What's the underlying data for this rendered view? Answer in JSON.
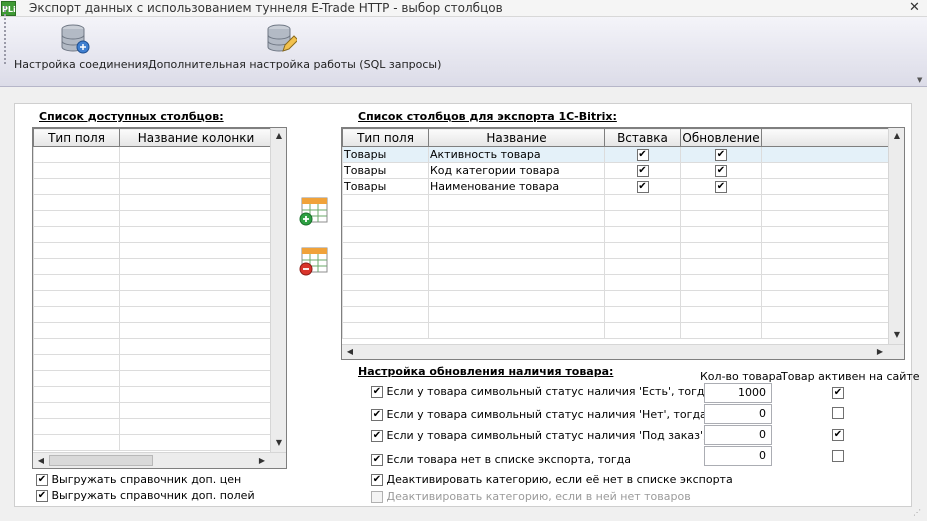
{
  "window": {
    "app_icon_text": "PLi",
    "title": "Экспорт данных с использованием туннеля E-Trade HTTP - выбор столбцов",
    "close_glyph": "✕"
  },
  "toolbar": {
    "btn_connection": "Настройка соединения",
    "btn_sql": "Дополнительная настройка работы (SQL запросы)"
  },
  "available": {
    "title": "Список доступных столбцов:",
    "columns": [
      "Тип поля",
      "Название колонки"
    ],
    "rows": []
  },
  "export": {
    "title": "Список столбцов для экспорта 1С-Bitrix:",
    "columns": [
      "Тип поля",
      "Название",
      "Вставка",
      "Обновление"
    ],
    "rows": [
      {
        "type": "Товары",
        "name": "Активность товара",
        "insert": true,
        "update": true
      },
      {
        "type": "Товары",
        "name": "Код категории товара",
        "insert": true,
        "update": true
      },
      {
        "type": "Товары",
        "name": "Наименование товара",
        "insert": true,
        "update": true
      }
    ]
  },
  "options": {
    "export_price_ref": {
      "label": "Выгружать справочник доп. цен",
      "checked": true
    },
    "export_field_ref": {
      "label": "Выгружать справочник доп. полей",
      "checked": true
    }
  },
  "availability": {
    "title": "Настройка обновления наличия товара:",
    "col_qty": "Кол-во товара",
    "col_active": "Товар активен на сайте",
    "rows": [
      {
        "label": "Если у товара символьный статус наличия 'Есть', тогда",
        "checked": true,
        "qty": "1000",
        "active": true
      },
      {
        "label": "Если у товара символьный статус наличия 'Нет', тогда",
        "checked": true,
        "qty": "0",
        "active": false
      },
      {
        "label": "Если у товара символьный статус наличия 'Под заказ', тогда",
        "checked": true,
        "qty": "0",
        "active": true
      },
      {
        "label": "Если товара нет в списке экспорта, тогда",
        "checked": true,
        "qty": "0",
        "active": false
      }
    ],
    "deactivate_missing": {
      "label": "Деактивировать категорию, если её нет в списке экспорта",
      "checked": true
    },
    "deactivate_empty": {
      "label": "Деактивировать категорию, если в ней нет товаров",
      "checked": false
    }
  }
}
